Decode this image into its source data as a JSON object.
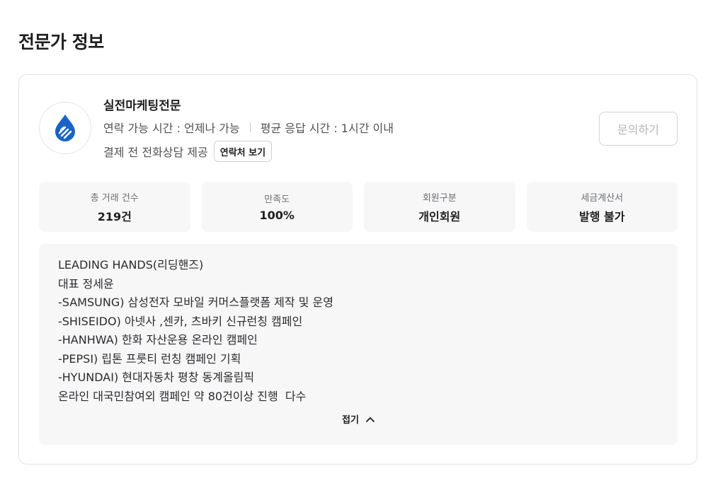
{
  "section_title": "전문가 정보",
  "expert": {
    "name": "실전마케팅전문",
    "contact_hours_label": "연락 가능 시간 : 언제나 가능",
    "response_time_label": "평균 응답 시간 : 1시간 이내",
    "pre_payment_call": "결제 전 전화상담 제공",
    "contact_view_button": "연락처 보기",
    "inquiry_button": "문의하기",
    "avatar_icon": "drop-hand-icon",
    "brand_color": "#1a63c6"
  },
  "stats": [
    {
      "label": "총 거래 건수",
      "value": "219건"
    },
    {
      "label": "만족도",
      "value": "100%"
    },
    {
      "label": "회원구분",
      "value": "개인회원"
    },
    {
      "label": "세금계산서",
      "value": "발행 불가"
    }
  ],
  "description": {
    "lines": [
      "LEADING HANDS(리딩핸즈)",
      "대표 정세윤",
      "-SAMSUNG) 삼성전자 모바일 커머스플랫폼 제작 및 운영",
      "-SHISEIDO) 아넷사 ,센카, 츠바키 신규런칭 캠페인",
      "-HANHWA) 한화 자산운용 온라인 캠페인",
      "-PEPSI) 립톤 프룻티 런칭 캠페인 기획",
      "-HYUNDAI) 현대자동차 평창 동계올림픽",
      "온라인 대국민참여외 캠페인 약 80건이상 진행  다수"
    ],
    "collapse_label": "접기",
    "collapse_icon": "chevron-up-icon"
  }
}
